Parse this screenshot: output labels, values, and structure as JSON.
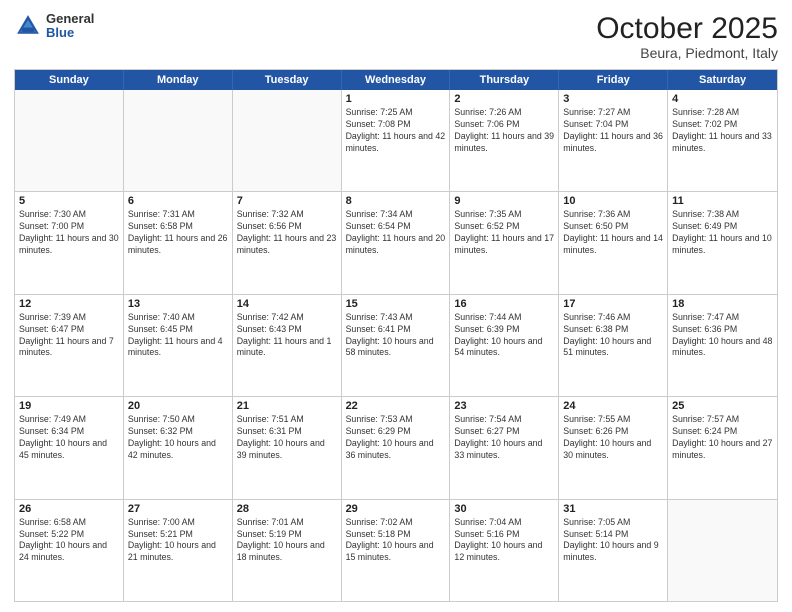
{
  "header": {
    "logo_general": "General",
    "logo_blue": "Blue",
    "month_year": "October 2025",
    "location": "Beura, Piedmont, Italy"
  },
  "weekdays": [
    "Sunday",
    "Monday",
    "Tuesday",
    "Wednesday",
    "Thursday",
    "Friday",
    "Saturday"
  ],
  "rows": [
    [
      {
        "day": "",
        "sunrise": "",
        "sunset": "",
        "daylight": "",
        "empty": true
      },
      {
        "day": "",
        "sunrise": "",
        "sunset": "",
        "daylight": "",
        "empty": true
      },
      {
        "day": "",
        "sunrise": "",
        "sunset": "",
        "daylight": "",
        "empty": true
      },
      {
        "day": "1",
        "sunrise": "Sunrise: 7:25 AM",
        "sunset": "Sunset: 7:08 PM",
        "daylight": "Daylight: 11 hours and 42 minutes."
      },
      {
        "day": "2",
        "sunrise": "Sunrise: 7:26 AM",
        "sunset": "Sunset: 7:06 PM",
        "daylight": "Daylight: 11 hours and 39 minutes."
      },
      {
        "day": "3",
        "sunrise": "Sunrise: 7:27 AM",
        "sunset": "Sunset: 7:04 PM",
        "daylight": "Daylight: 11 hours and 36 minutes."
      },
      {
        "day": "4",
        "sunrise": "Sunrise: 7:28 AM",
        "sunset": "Sunset: 7:02 PM",
        "daylight": "Daylight: 11 hours and 33 minutes."
      }
    ],
    [
      {
        "day": "5",
        "sunrise": "Sunrise: 7:30 AM",
        "sunset": "Sunset: 7:00 PM",
        "daylight": "Daylight: 11 hours and 30 minutes."
      },
      {
        "day": "6",
        "sunrise": "Sunrise: 7:31 AM",
        "sunset": "Sunset: 6:58 PM",
        "daylight": "Daylight: 11 hours and 26 minutes."
      },
      {
        "day": "7",
        "sunrise": "Sunrise: 7:32 AM",
        "sunset": "Sunset: 6:56 PM",
        "daylight": "Daylight: 11 hours and 23 minutes."
      },
      {
        "day": "8",
        "sunrise": "Sunrise: 7:34 AM",
        "sunset": "Sunset: 6:54 PM",
        "daylight": "Daylight: 11 hours and 20 minutes."
      },
      {
        "day": "9",
        "sunrise": "Sunrise: 7:35 AM",
        "sunset": "Sunset: 6:52 PM",
        "daylight": "Daylight: 11 hours and 17 minutes."
      },
      {
        "day": "10",
        "sunrise": "Sunrise: 7:36 AM",
        "sunset": "Sunset: 6:50 PM",
        "daylight": "Daylight: 11 hours and 14 minutes."
      },
      {
        "day": "11",
        "sunrise": "Sunrise: 7:38 AM",
        "sunset": "Sunset: 6:49 PM",
        "daylight": "Daylight: 11 hours and 10 minutes."
      }
    ],
    [
      {
        "day": "12",
        "sunrise": "Sunrise: 7:39 AM",
        "sunset": "Sunset: 6:47 PM",
        "daylight": "Daylight: 11 hours and 7 minutes."
      },
      {
        "day": "13",
        "sunrise": "Sunrise: 7:40 AM",
        "sunset": "Sunset: 6:45 PM",
        "daylight": "Daylight: 11 hours and 4 minutes."
      },
      {
        "day": "14",
        "sunrise": "Sunrise: 7:42 AM",
        "sunset": "Sunset: 6:43 PM",
        "daylight": "Daylight: 11 hours and 1 minute."
      },
      {
        "day": "15",
        "sunrise": "Sunrise: 7:43 AM",
        "sunset": "Sunset: 6:41 PM",
        "daylight": "Daylight: 10 hours and 58 minutes."
      },
      {
        "day": "16",
        "sunrise": "Sunrise: 7:44 AM",
        "sunset": "Sunset: 6:39 PM",
        "daylight": "Daylight: 10 hours and 54 minutes."
      },
      {
        "day": "17",
        "sunrise": "Sunrise: 7:46 AM",
        "sunset": "Sunset: 6:38 PM",
        "daylight": "Daylight: 10 hours and 51 minutes."
      },
      {
        "day": "18",
        "sunrise": "Sunrise: 7:47 AM",
        "sunset": "Sunset: 6:36 PM",
        "daylight": "Daylight: 10 hours and 48 minutes."
      }
    ],
    [
      {
        "day": "19",
        "sunrise": "Sunrise: 7:49 AM",
        "sunset": "Sunset: 6:34 PM",
        "daylight": "Daylight: 10 hours and 45 minutes."
      },
      {
        "day": "20",
        "sunrise": "Sunrise: 7:50 AM",
        "sunset": "Sunset: 6:32 PM",
        "daylight": "Daylight: 10 hours and 42 minutes."
      },
      {
        "day": "21",
        "sunrise": "Sunrise: 7:51 AM",
        "sunset": "Sunset: 6:31 PM",
        "daylight": "Daylight: 10 hours and 39 minutes."
      },
      {
        "day": "22",
        "sunrise": "Sunrise: 7:53 AM",
        "sunset": "Sunset: 6:29 PM",
        "daylight": "Daylight: 10 hours and 36 minutes."
      },
      {
        "day": "23",
        "sunrise": "Sunrise: 7:54 AM",
        "sunset": "Sunset: 6:27 PM",
        "daylight": "Daylight: 10 hours and 33 minutes."
      },
      {
        "day": "24",
        "sunrise": "Sunrise: 7:55 AM",
        "sunset": "Sunset: 6:26 PM",
        "daylight": "Daylight: 10 hours and 30 minutes."
      },
      {
        "day": "25",
        "sunrise": "Sunrise: 7:57 AM",
        "sunset": "Sunset: 6:24 PM",
        "daylight": "Daylight: 10 hours and 27 minutes."
      }
    ],
    [
      {
        "day": "26",
        "sunrise": "Sunrise: 6:58 AM",
        "sunset": "Sunset: 5:22 PM",
        "daylight": "Daylight: 10 hours and 24 minutes."
      },
      {
        "day": "27",
        "sunrise": "Sunrise: 7:00 AM",
        "sunset": "Sunset: 5:21 PM",
        "daylight": "Daylight: 10 hours and 21 minutes."
      },
      {
        "day": "28",
        "sunrise": "Sunrise: 7:01 AM",
        "sunset": "Sunset: 5:19 PM",
        "daylight": "Daylight: 10 hours and 18 minutes."
      },
      {
        "day": "29",
        "sunrise": "Sunrise: 7:02 AM",
        "sunset": "Sunset: 5:18 PM",
        "daylight": "Daylight: 10 hours and 15 minutes."
      },
      {
        "day": "30",
        "sunrise": "Sunrise: 7:04 AM",
        "sunset": "Sunset: 5:16 PM",
        "daylight": "Daylight: 10 hours and 12 minutes."
      },
      {
        "day": "31",
        "sunrise": "Sunrise: 7:05 AM",
        "sunset": "Sunset: 5:14 PM",
        "daylight": "Daylight: 10 hours and 9 minutes."
      },
      {
        "day": "",
        "sunrise": "",
        "sunset": "",
        "daylight": "",
        "empty": true
      }
    ]
  ]
}
